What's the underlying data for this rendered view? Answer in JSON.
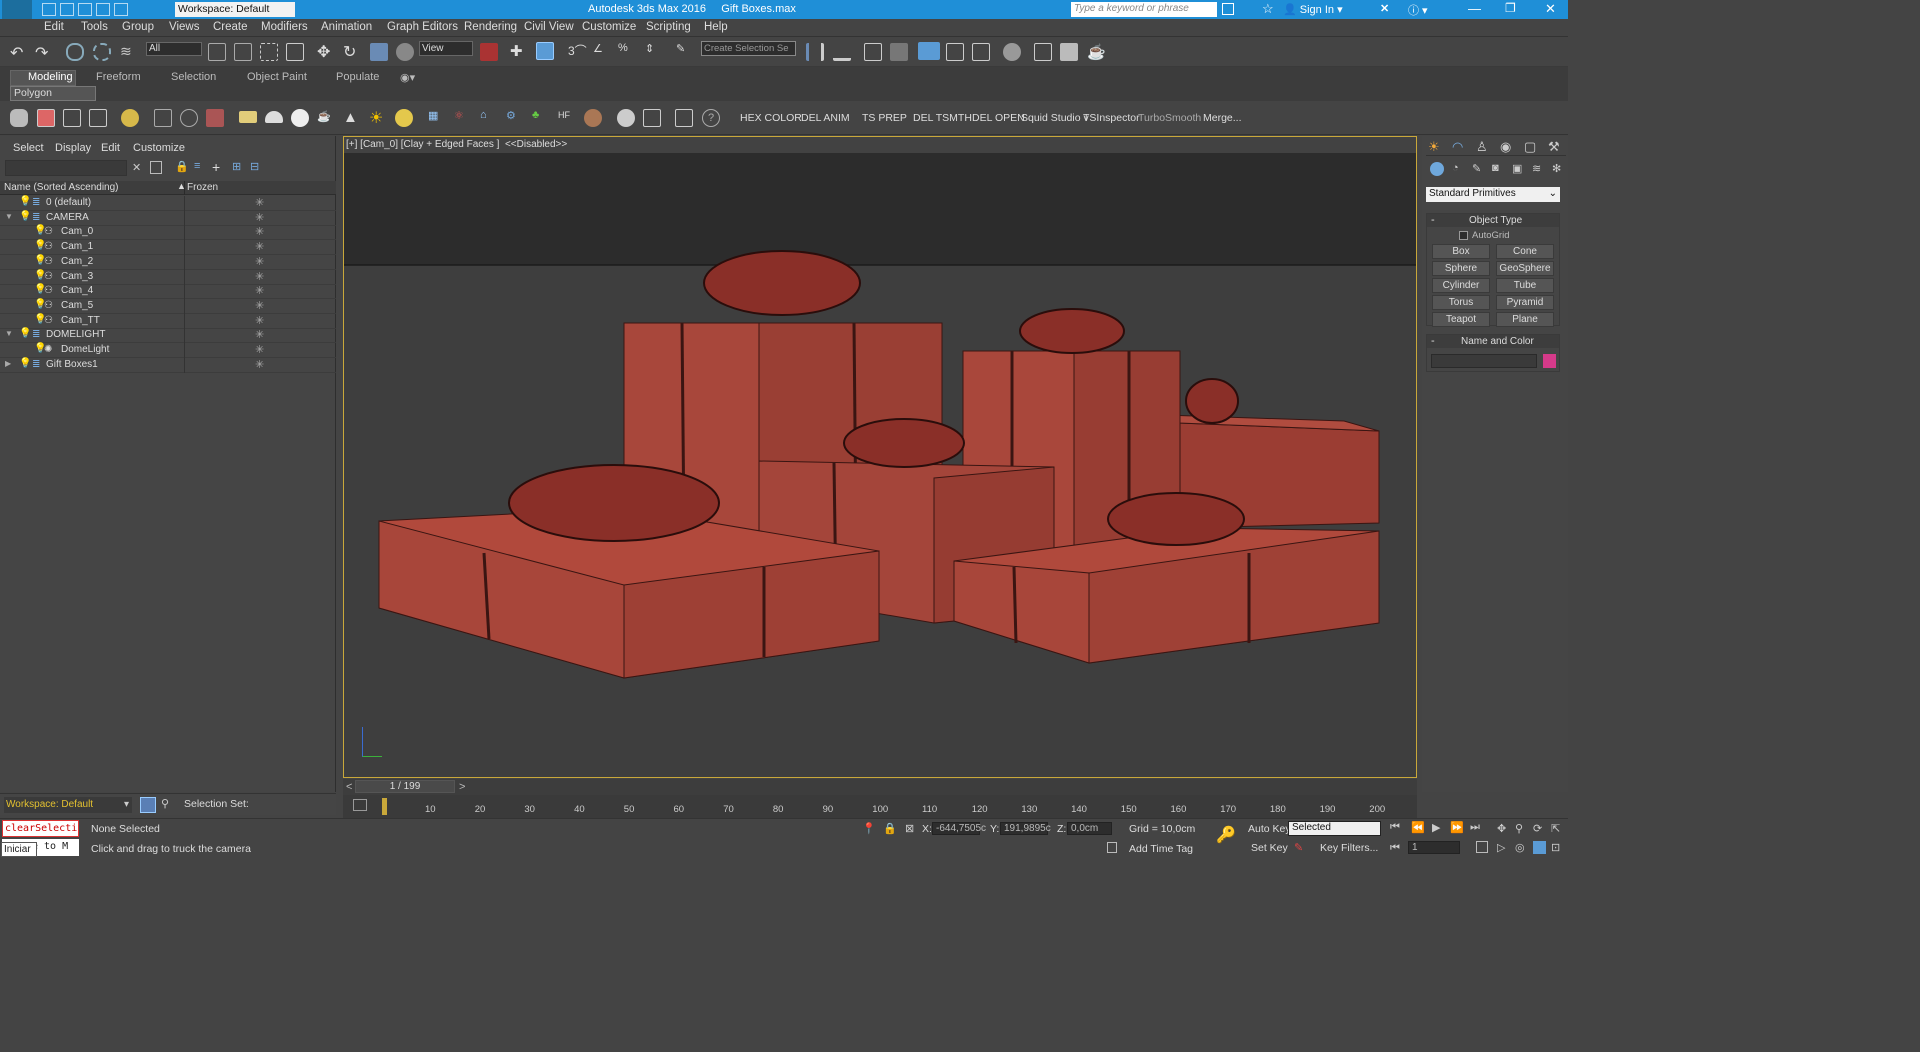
{
  "title_bar": {
    "workspace": "Workspace: Default",
    "title": "Autodesk 3ds Max 2016     Gift Boxes.max",
    "search_placeholder": "Type a keyword or phrase",
    "sign_in": "Sign In"
  },
  "menu": [
    "Edit",
    "Tools",
    "Group",
    "Views",
    "Create",
    "Modifiers",
    "Animation",
    "Graph Editors",
    "Rendering",
    "Civil View",
    "Customize",
    "Scripting",
    "Help"
  ],
  "toolbar": {
    "filter": "All",
    "ref_coord": "View",
    "selection_set": "Create Selection Se"
  },
  "ribbon": {
    "tabs": [
      "Modeling",
      "Freeform",
      "Selection",
      "Object Paint",
      "Populate"
    ],
    "sub_label": "Polygon Modeling"
  },
  "shelf_buttons": [
    "HEX COLOR",
    "DEL ANIM",
    "TS PREP",
    "DEL TSMTH",
    "DEL OPEN",
    "Squid Studio v",
    "TSInspector",
    "TurboSmooth",
    "Merge..."
  ],
  "scene_explorer": {
    "menu": [
      "Select",
      "Display",
      "Edit",
      "Customize"
    ],
    "col_name": "Name (Sorted Ascending)",
    "col_frozen": "Frozen",
    "rows": [
      "0 (default)",
      "CAMERA",
      "Cam_0",
      "Cam_1",
      "Cam_2",
      "Cam_3",
      "Cam_4",
      "Cam_5",
      "Cam_TT",
      "DOMELIGHT",
      "DomeLight",
      "Gift Boxes1"
    ],
    "workspace": "Workspace: Default",
    "selection_set": "Selection Set:"
  },
  "viewport": {
    "label": "[+] [Cam_0] [Clay + Edged Faces ]  <<Disabled>>"
  },
  "command_panel": {
    "category": "Standard Primitives",
    "rollout_object_type": "Object Type",
    "autogrid": "AutoGrid",
    "primitives": [
      "Box",
      "Cone",
      "Sphere",
      "GeoSphere",
      "Cylinder",
      "Tube",
      "Torus",
      "Pyramid",
      "Teapot",
      "Plane"
    ],
    "rollout_name_color": "Name and Color",
    "object_color": "#d63a8a"
  },
  "timeline": {
    "frame": "1 / 199",
    "ticks": [
      "10",
      "20",
      "30",
      "40",
      "50",
      "60",
      "70",
      "80",
      "90",
      "100",
      "110",
      "120",
      "130",
      "140",
      "150",
      "160",
      "170",
      "180",
      "190",
      "200"
    ]
  },
  "status": {
    "maxscript": "clearSelecti",
    "maxscript2": "e to M",
    "iniciar": "Iniciar",
    "selection": "None Selected",
    "prompt": "Click and drag to truck the camera",
    "x_label": "X:",
    "x": "-644,7505c",
    "y_label": "Y:",
    "y": "191,9895c",
    "z_label": "Z:",
    "z": "0,0cm",
    "grid": "Grid = 10,0cm",
    "add_time_tag": "Add Time Tag",
    "auto_key": "Auto Key",
    "set_key": "Set Key",
    "key_mode": "Selected",
    "key_filters": "Key Filters...",
    "current_frame": "1"
  }
}
